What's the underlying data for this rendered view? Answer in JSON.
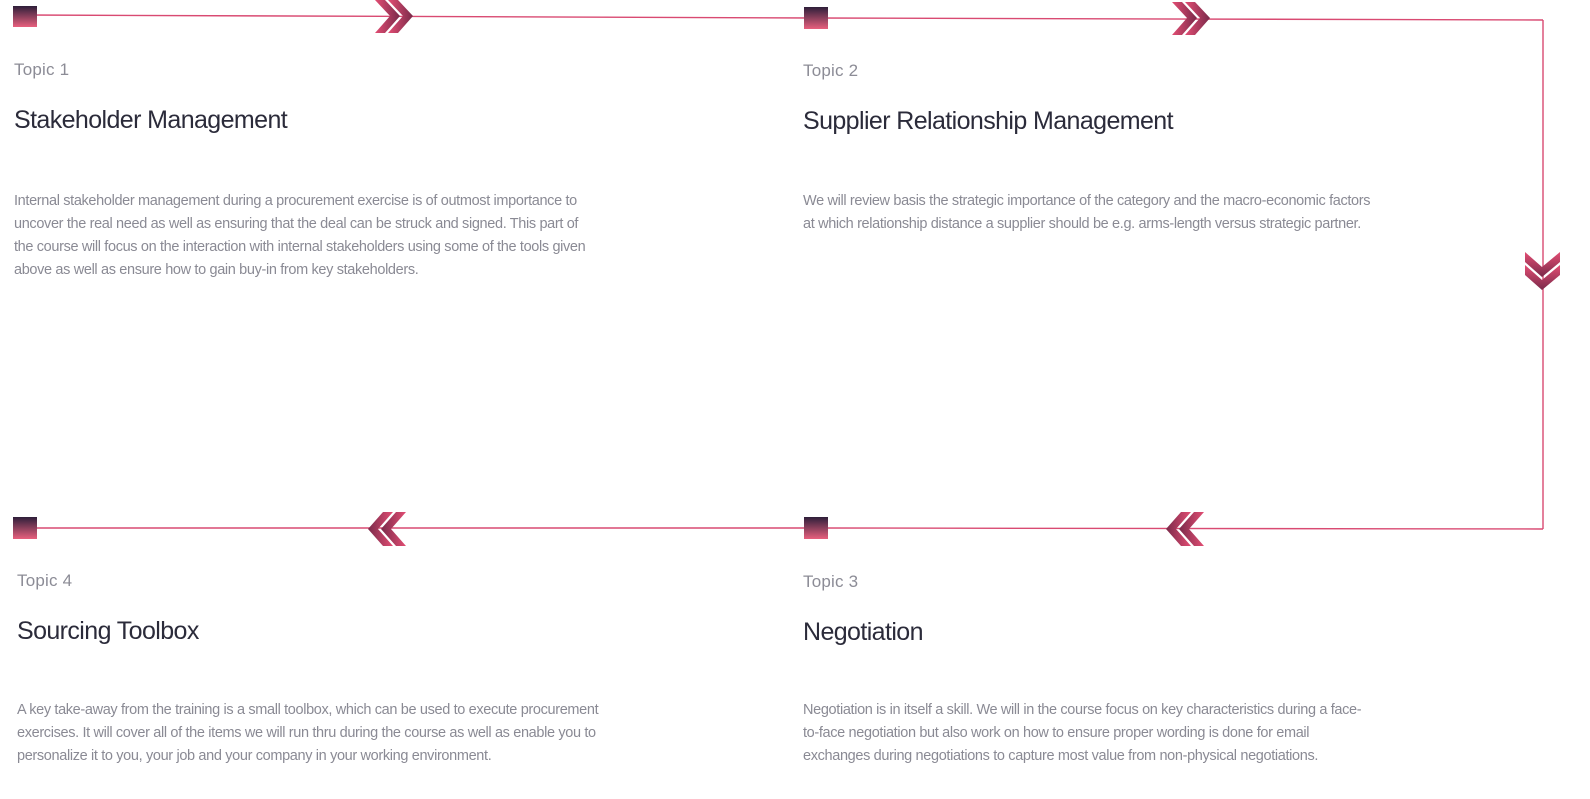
{
  "colors": {
    "line": "#d94a72",
    "marker_top": "#2e1f3a",
    "marker_bottom": "#e8607e",
    "chevron_light": "#e24d73",
    "chevron_dark": "#7a2a4a"
  },
  "icons": [
    "square-marker-icon",
    "double-chevron-right-icon",
    "double-chevron-left-icon",
    "double-chevron-down-icon"
  ],
  "topics": [
    {
      "label": "Topic 1",
      "title": "Stakeholder Management",
      "description": "Internal stakeholder management during a procurement exercise is of outmost importance to uncover the real need as well as ensuring that the deal can be struck and signed. This part of the course will focus on the interaction with internal stakeholders using some of the tools given above as well as ensure how to gain buy-in from key stakeholders."
    },
    {
      "label": "Topic 2",
      "title": "Supplier Relationship Management",
      "description": "We will review basis the strategic importance of the category and the macro-economic factors at which relationship distance a supplier should be e.g. arms-length versus strategic partner."
    },
    {
      "label": "Topic 3",
      "title": "Negotiation",
      "description": "Negotiation is in itself a skill. We will in the course focus on key characteristics during a face-to-face negotiation but also work on how to ensure proper wording is done for email exchanges during negotiations to capture most value from non-physical negotiations."
    },
    {
      "label": "Topic 4",
      "title": "Sourcing Toolbox",
      "description": "A key take-away from the training is a small toolbox, which can be used to execute procurement exercises. It will cover all of the items we will run thru during the course as well as enable you to personalize it to you, your job and your company in your working environment."
    }
  ]
}
